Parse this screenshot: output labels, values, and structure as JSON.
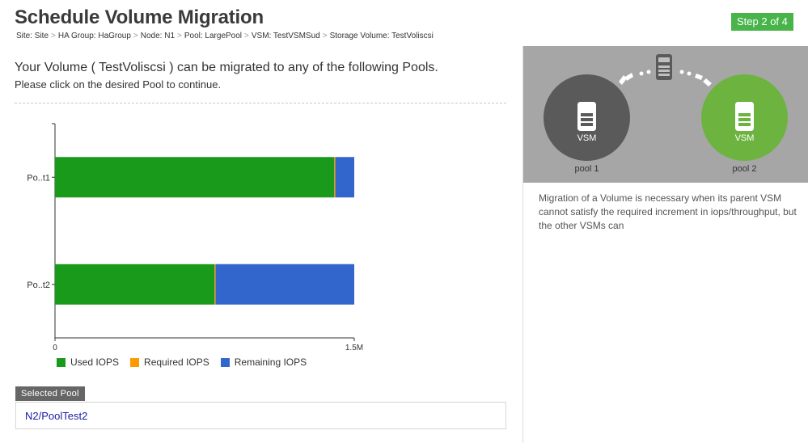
{
  "header": {
    "title": "Schedule Volume Migration",
    "step": "Step 2 of 4"
  },
  "breadcrumb": [
    "Site: Site",
    "HA Group: HaGroup",
    "Node: N1",
    "Pool: LargePool",
    "VSM: TestVSMSud",
    "Storage Volume: TestVoliscsi"
  ],
  "intro": {
    "title": "Your Volume ( TestVoliscsi ) can be migrated to any of the following Pools.",
    "subtitle": "Please click on the desired Pool to continue."
  },
  "chart_data": {
    "type": "bar",
    "orientation": "horizontal",
    "stacked": true,
    "categories": [
      "Po..t1",
      "Po..t2"
    ],
    "series": [
      {
        "name": "Used IOPS",
        "color": "#1a9a1a",
        "values": [
          1400000,
          800000
        ]
      },
      {
        "name": "Required IOPS",
        "color": "#ff9900",
        "values": [
          5000,
          5000
        ]
      },
      {
        "name": "Remaining IOPS",
        "color": "#3366cc",
        "values": [
          95000,
          695000
        ]
      }
    ],
    "xlim": [
      0,
      1500000
    ],
    "x_ticks": [
      "0",
      "1.5M"
    ],
    "legend_position": "bottom"
  },
  "selected_pool": {
    "label": "Selected Pool",
    "value": "N2/PoolTest2"
  },
  "diagram": {
    "source_vsm": "VSM",
    "target_vsm": "VSM",
    "source_pool": "pool 1",
    "target_pool": "pool 2",
    "source_color": "#5a5a5a",
    "target_color": "#6db33f"
  },
  "description": "Migration of a Volume is necessary when its parent VSM cannot satisfy the required increment in iops/throughput, but the other VSMs can"
}
